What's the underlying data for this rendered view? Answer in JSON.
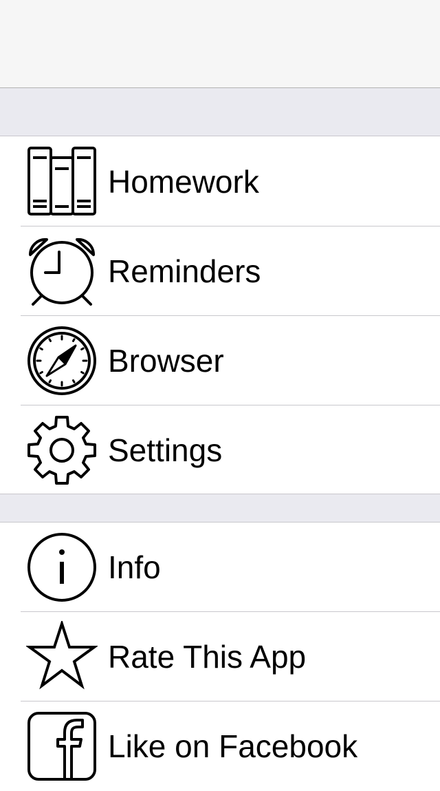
{
  "menu": {
    "group1": [
      {
        "label": "Homework",
        "icon": "books-icon"
      },
      {
        "label": "Reminders",
        "icon": "alarm-clock-icon"
      },
      {
        "label": "Browser",
        "icon": "compass-icon"
      },
      {
        "label": "Settings",
        "icon": "gear-icon"
      }
    ],
    "group2": [
      {
        "label": "Info",
        "icon": "info-icon"
      },
      {
        "label": "Rate This App",
        "icon": "star-icon"
      },
      {
        "label": "Like on Facebook",
        "icon": "facebook-icon"
      }
    ]
  },
  "colors": {
    "navbar_bg": "#f6f6f6",
    "section_bg": "#eaeaf0",
    "separator": "#c8c7cc",
    "text": "#000000"
  }
}
